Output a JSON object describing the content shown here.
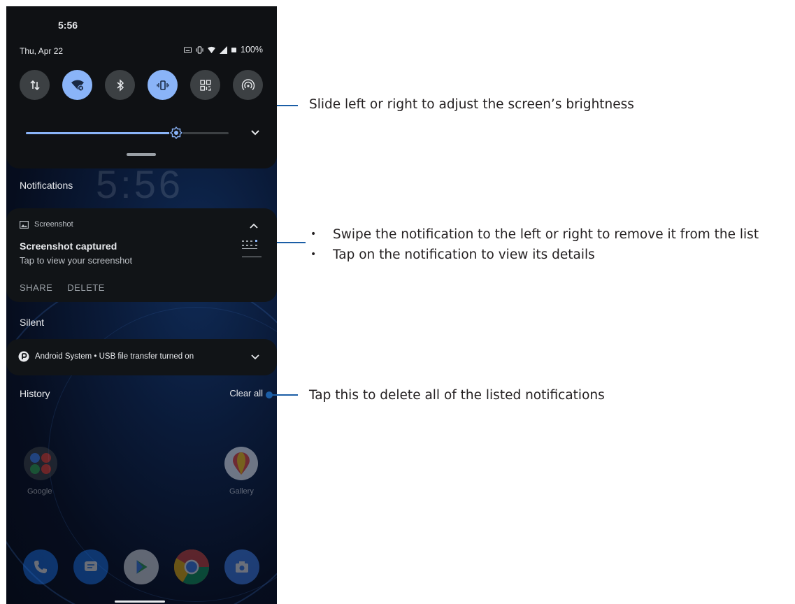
{
  "status_bar": {
    "time": "5:56",
    "date": "Thu, Apr 22",
    "battery": "100%"
  },
  "quick_settings": {
    "tiles": [
      {
        "name": "data-tile",
        "icon": "mobile-data-icon",
        "active": false
      },
      {
        "name": "wifi-tile",
        "icon": "wifi-off-icon",
        "active": true
      },
      {
        "name": "bluetooth-tile",
        "icon": "bluetooth-icon",
        "active": false
      },
      {
        "name": "vibrate-tile",
        "icon": "vibrate-icon",
        "active": true
      },
      {
        "name": "qr-tile",
        "icon": "qr-code-icon",
        "active": false
      },
      {
        "name": "hotspot-tile",
        "icon": "hotspot-icon",
        "active": false
      }
    ],
    "brightness": 0.74
  },
  "lockscreen_clock": "5:56",
  "sections": {
    "notifications": "Notifications",
    "silent": "Silent",
    "history": "History",
    "clear_all": "Clear all"
  },
  "screenshot_notification": {
    "app": "Screenshot",
    "title": "Screenshot captured",
    "text": "Tap to view your screenshot",
    "actions": [
      "SHARE",
      "DELETE"
    ]
  },
  "silent_notification": {
    "text": "Android System • USB file transfer turned on"
  },
  "home_apps": {
    "google_label": "Google",
    "gallery_label": "Gallery"
  },
  "callouts": {
    "brightness": "Slide left or right to adjust the screen’s brightness",
    "notification_bullets": [
      "Swipe the notification to the left or right to remove it from the list",
      "Tap on the notification to view its details"
    ],
    "clear_all": "Tap this to delete all of the listed notifications"
  },
  "colors": {
    "accent": "#8ab4f8",
    "callout_line": "#1b5ea6",
    "panel": "#0f1114"
  }
}
